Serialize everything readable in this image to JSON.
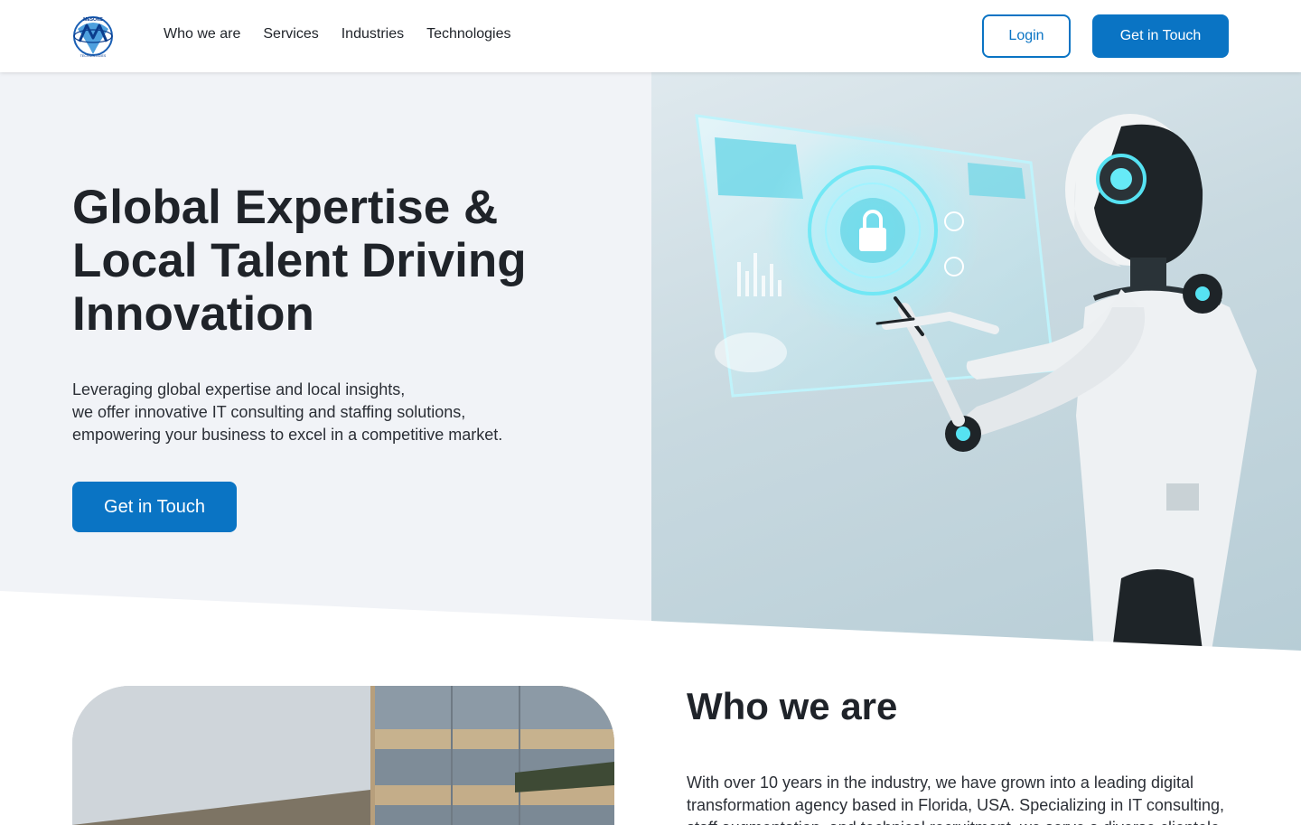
{
  "header": {
    "logo_text_top": "MESONS",
    "logo_text_bottom": "TECHNOLOGIES",
    "nav": [
      "Who we are",
      "Services",
      "Industries",
      "Technologies"
    ],
    "login_label": "Login",
    "cta_label": "Get in Touch"
  },
  "hero": {
    "title_lines": [
      "Global Expertise &",
      "Local Talent Driving",
      "Innovation"
    ],
    "text_lines": [
      "Leveraging global expertise and local insights,",
      "we offer innovative IT consulting and staffing solutions,",
      "empowering your business to excel in a competitive market."
    ],
    "cta_label": "Get in Touch",
    "image": "robot-touching-holographic-security-screen"
  },
  "who": {
    "title": "Who we are",
    "text": "With over 10 years in the industry, we have grown into a leading digital transformation agency based in Florida, USA. Specializing in IT consulting, staff augmentation, and technical recruitment, we serve a diverse clientele",
    "image": "office-building-photo"
  },
  "colors": {
    "primary": "#0a74c4",
    "hero_bg": "#f1f3f7",
    "text": "#1f2329"
  }
}
